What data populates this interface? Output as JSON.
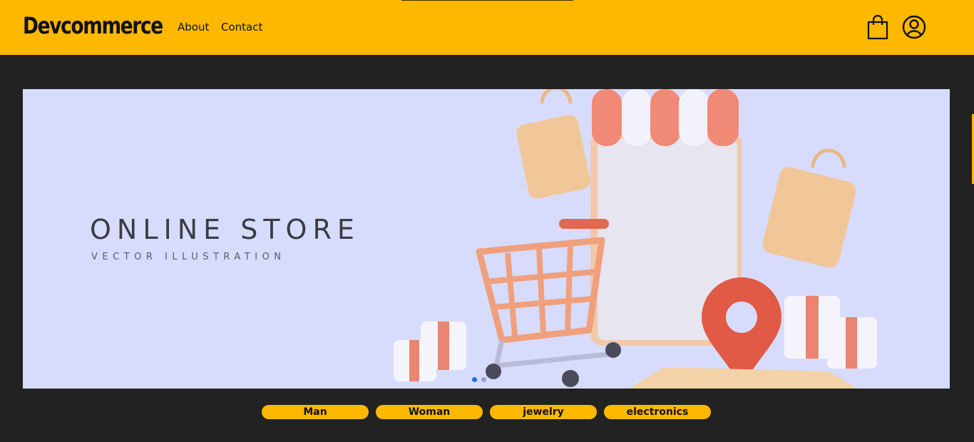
{
  "header": {
    "logo": "Devcommerce",
    "links": [
      {
        "label": "About"
      },
      {
        "label": "Contact"
      }
    ],
    "icons": [
      "shopping-bag-icon",
      "user-icon"
    ]
  },
  "hero": {
    "title": "ONLINE STORE",
    "subtitle": "VECTOR ILLUSTRATION",
    "carousel_slides": 2,
    "active_slide": 1
  },
  "categories": [
    {
      "label": "Man"
    },
    {
      "label": "Woman"
    },
    {
      "label": "jewelry"
    },
    {
      "label": "electronics"
    }
  ],
  "colors": {
    "accent": "#ffb800",
    "background": "#222222",
    "hero_bg": "#d8dcfc",
    "active_dot": "#1a73e8"
  }
}
